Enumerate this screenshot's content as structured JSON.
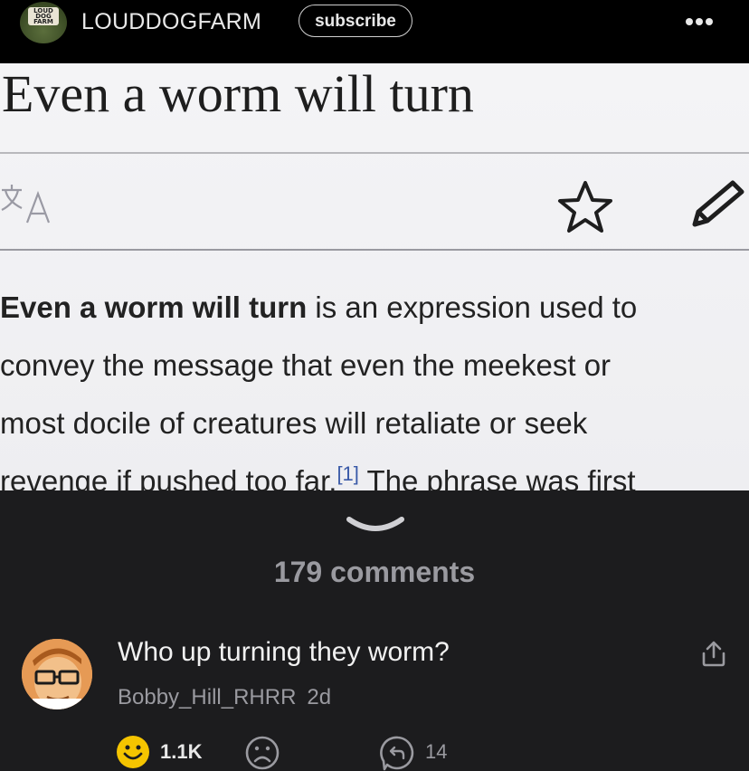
{
  "header": {
    "logo_text": "LOUD DOG FARM",
    "channel_name": "LOUDDOGFARM",
    "subscribe_label": "subscribe",
    "more_icon": "more-horizontal-icon"
  },
  "post_image": {
    "title": "Even a worm will turn",
    "body_lines": [
      {
        "bold": "Even a worm will turn",
        "rest": " is an expression used to"
      },
      {
        "bold": "",
        "rest": "convey the message that even the meekest or"
      },
      {
        "bold": "",
        "rest": "most docile of creatures will retaliate or seek"
      },
      {
        "bold": "",
        "rest": "revenge if pushed too far.",
        "cite": "[1]",
        "after": " The phrase was first"
      }
    ],
    "icons": [
      "translate-icon",
      "star-icon",
      "pencil-icon"
    ]
  },
  "comments": {
    "count_label": "179 comments",
    "items": [
      {
        "text": "Who up turning they worm?",
        "author": "Bobby_Hill_RHRR",
        "time": "2d",
        "likes": "1.1K",
        "replies": "14"
      }
    ]
  },
  "colors": {
    "background": "#1c1c1e",
    "header": "#000000",
    "smile_yellow": "#f5c400",
    "muted_text": "#9a9aa0",
    "cite_blue": "#3a5aa8"
  }
}
